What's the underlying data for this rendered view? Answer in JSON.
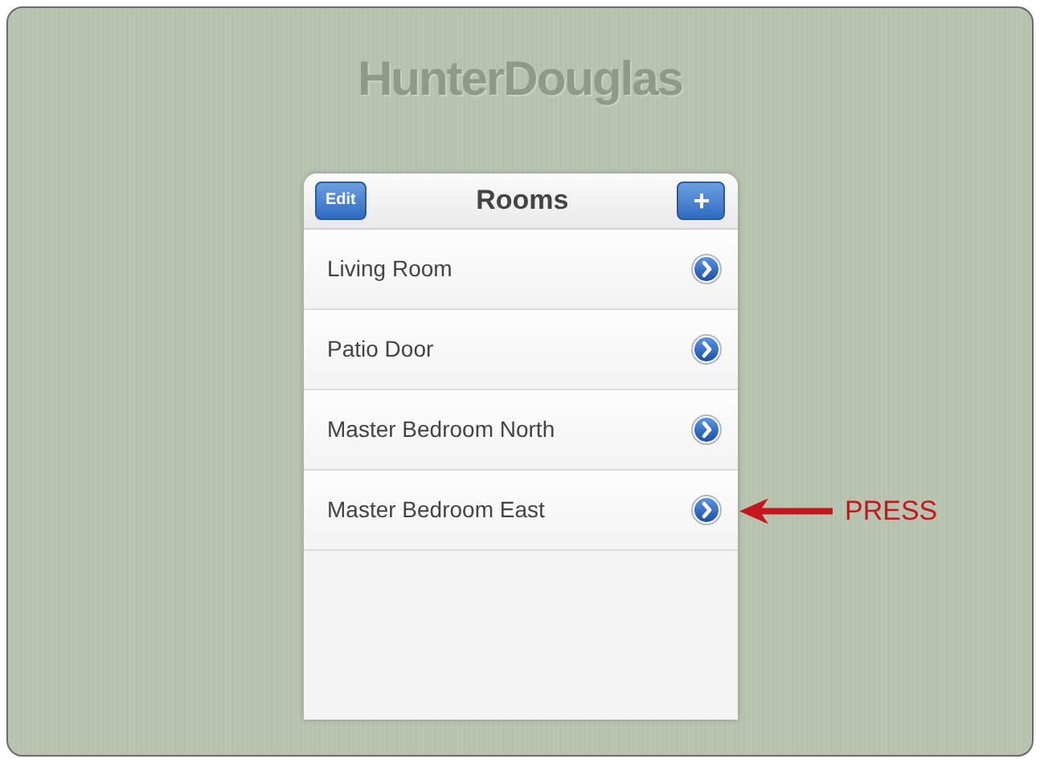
{
  "logo": "HunterDouglas",
  "navbar": {
    "edit_button": "Edit",
    "title": "Rooms",
    "add_button": "+"
  },
  "rooms": [
    {
      "name": "Living Room",
      "annotated": false
    },
    {
      "name": "Patio Door",
      "annotated": false
    },
    {
      "name": "Master Bedroom North",
      "annotated": false
    },
    {
      "name": "Master Bedroom East",
      "annotated": true
    }
  ],
  "annotation": {
    "label": "PRESS"
  }
}
